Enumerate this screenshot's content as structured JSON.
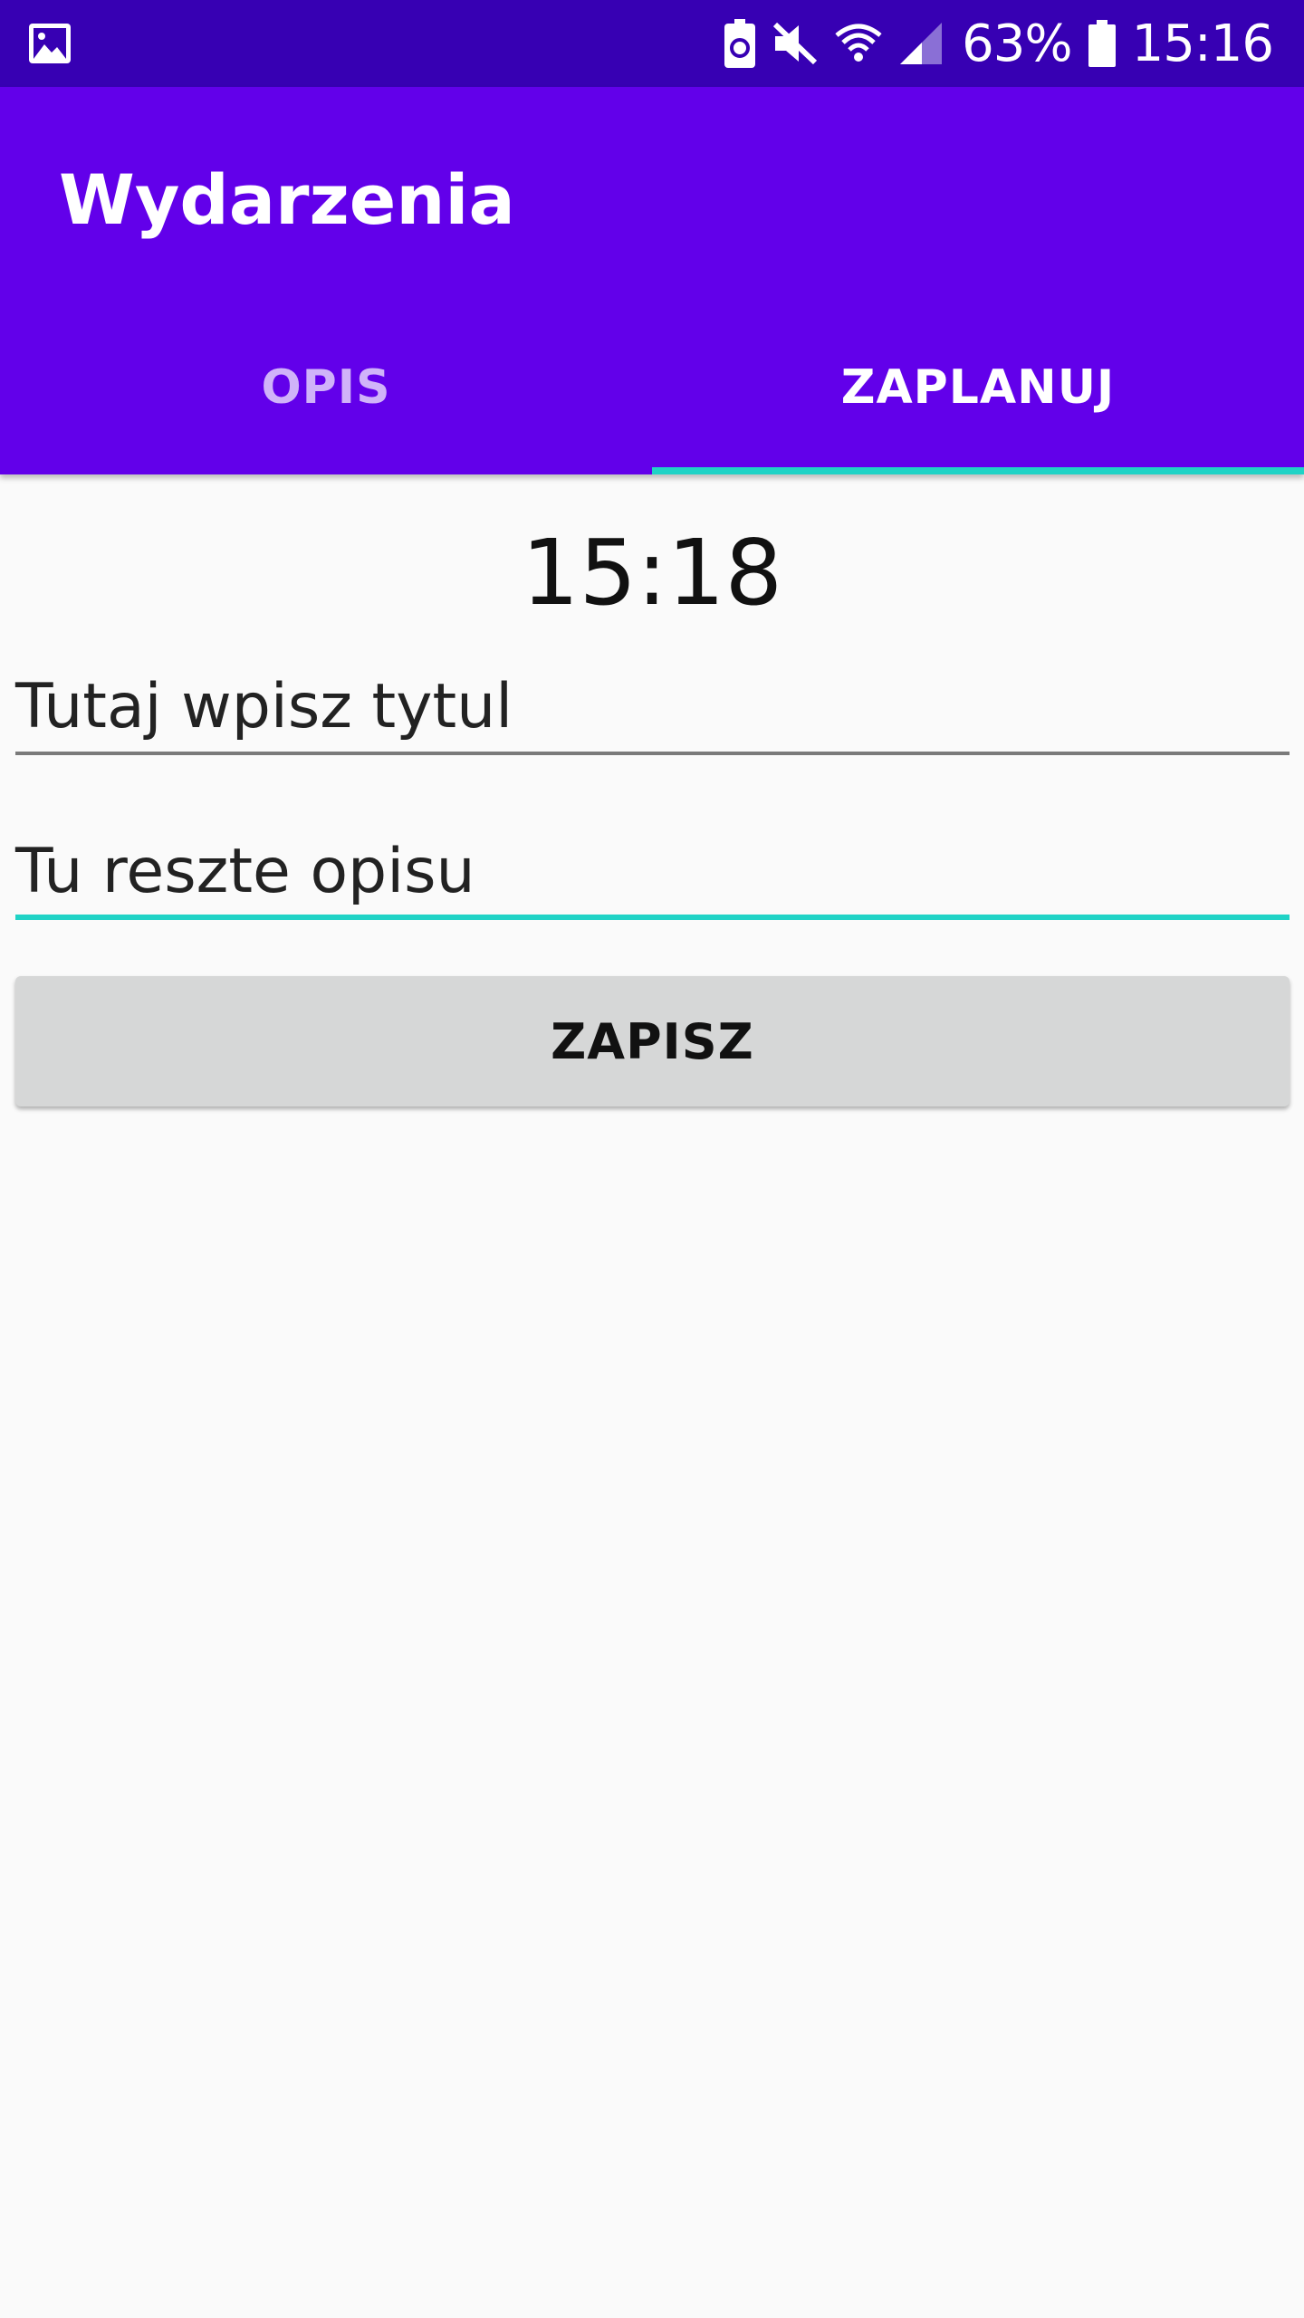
{
  "status_bar": {
    "icons": [
      "gallery-icon",
      "battery-saver-icon",
      "mute-icon",
      "wifi-icon",
      "signal-icon",
      "battery-icon"
    ],
    "battery_percent": "63%",
    "time": "15:16"
  },
  "app_bar": {
    "title": "Wydarzenia",
    "background": "#6200ea"
  },
  "tabs": [
    {
      "label": "OPIS",
      "selected": false
    },
    {
      "label": "ZAPLANUJ",
      "selected": true
    }
  ],
  "form": {
    "time": "15:18",
    "title_field": {
      "value": "Tutaj wpisz tytul",
      "focused": false
    },
    "description_field": {
      "value": "Tu reszte opisu",
      "focused": true
    },
    "save_label": "ZAPISZ"
  },
  "colors": {
    "accent": "#20d3c6",
    "status_bar": "#3700b3",
    "background": "#fafafa"
  }
}
